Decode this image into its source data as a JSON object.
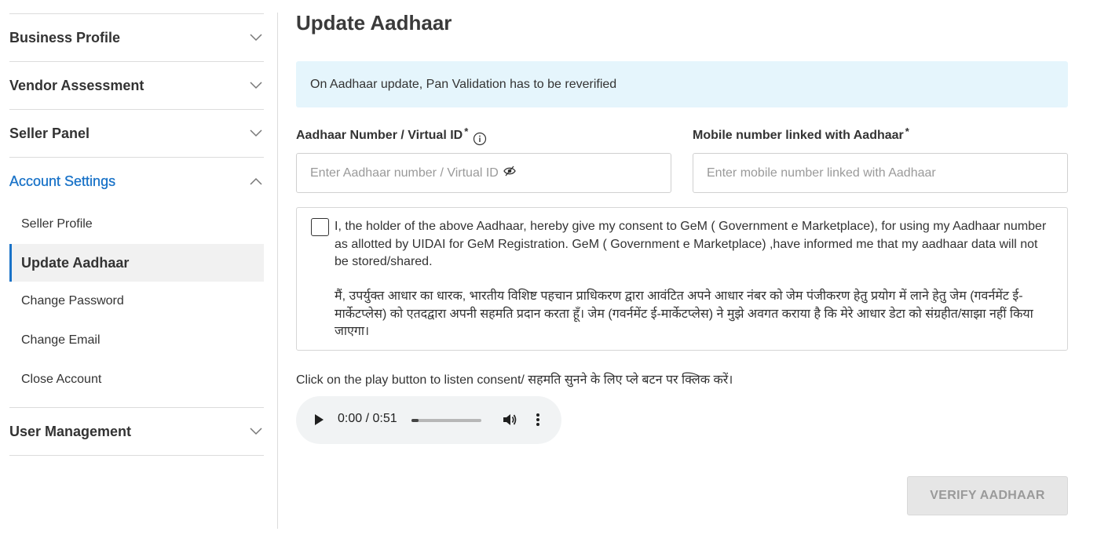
{
  "sidebar": {
    "sections": [
      {
        "label": "Business Profile",
        "expanded": false
      },
      {
        "label": "Vendor Assessment",
        "expanded": false
      },
      {
        "label": "Seller Panel",
        "expanded": false
      },
      {
        "label": "Account Settings",
        "expanded": true
      }
    ],
    "account_settings_items": [
      {
        "label": "Seller Profile"
      },
      {
        "label": "Update Aadhaar",
        "active": true
      },
      {
        "label": "Change Password"
      },
      {
        "label": "Change Email"
      },
      {
        "label": "Close Account"
      }
    ],
    "user_management": {
      "label": "User Management"
    },
    "accent_color": "#1a73c8"
  },
  "main": {
    "title": "Update Aadhaar",
    "notice": "On Aadhaar update, Pan Validation has to be reverified",
    "aadhaar_field": {
      "label": "Aadhaar Number / Virtual ID",
      "required_mark": "*",
      "placeholder": "Enter Aadhaar number / Virtual ID",
      "icon": "info-icon",
      "toggle_icon": "eye-slash-icon"
    },
    "mobile_field": {
      "label": "Mobile number linked with Aadhaar",
      "required_mark": "*",
      "placeholder": "Enter mobile number linked with Aadhaar"
    },
    "consent": {
      "checked": false,
      "english": "I, the holder of the above Aadhaar, hereby give my consent to GeM ( Government e Marketplace), for using my Aadhaar number as allotted by UIDAI for GeM Registration. GeM ( Government e Marketplace) ,have informed me that my aadhaar data will not be stored/shared.",
      "hindi": "मैं, उपर्युक्त आधार का धारक, भारतीय विशिष्ट पहचान प्राधिकरण द्वारा आवंटित अपने आधार नंबर को जेम पंजीकरण हेतु प्रयोग में लाने हेतु जेम (गवर्नमेंट ई-मार्केटप्लेस) को एतदद्वारा अपनी सहमति प्रदान करता हूँ। जेम (गवर्नमेंट ई-मार्केटप्लेस) ने मुझे अवगत कराया है कि मेरे आधार डेटा को संग्रहीत/साझा नहीं किया जाएगा।"
    },
    "listen_text": "Click on the play button to listen consent/ सहमति सुनने के लिए प्ले बटन पर क्लिक करें।",
    "audio": {
      "time": "0:00 / 0:51",
      "progress": 0.0
    },
    "verify_button": "VERIFY AADHAAR"
  }
}
